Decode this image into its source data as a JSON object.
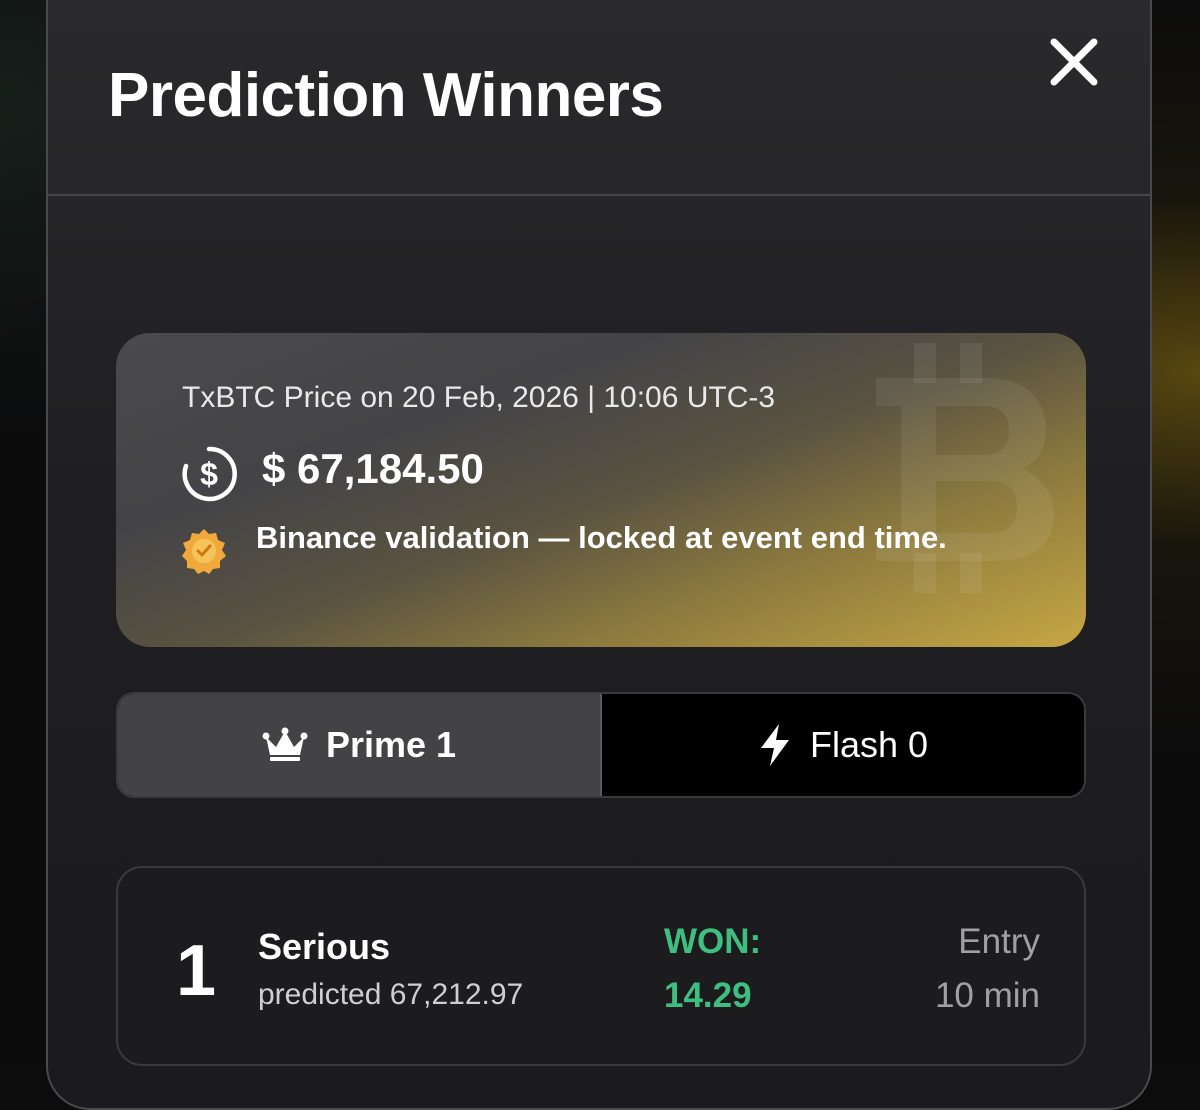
{
  "modal": {
    "title": "Prediction Winners"
  },
  "price_card": {
    "date_line": "TxBTC Price on 20 Feb, 2026 | 10:06 UTC-3",
    "price": "$ 67,184.50",
    "validation": "Binance validation — locked at event end time.",
    "icons": {
      "price": "dollar-circle-icon",
      "validation": "verified-badge-icon",
      "watermark": "bitcoin-icon"
    }
  },
  "tabs": [
    {
      "label": "Prime 1",
      "icon": "crown-icon",
      "active": true
    },
    {
      "label": "Flash 0",
      "icon": "lightning-icon",
      "active": false
    }
  ],
  "winners": [
    {
      "rank": "1",
      "name": "Serious",
      "prediction": "predicted 67,212.97",
      "won_label": "WON:",
      "won_value": "14.29",
      "entry_label": "Entry",
      "entry_value": "10 min"
    }
  ],
  "colors": {
    "accent_gold": "#c7a744",
    "won_green": "#3fbf7f",
    "badge_orange": "#f2a93b"
  }
}
